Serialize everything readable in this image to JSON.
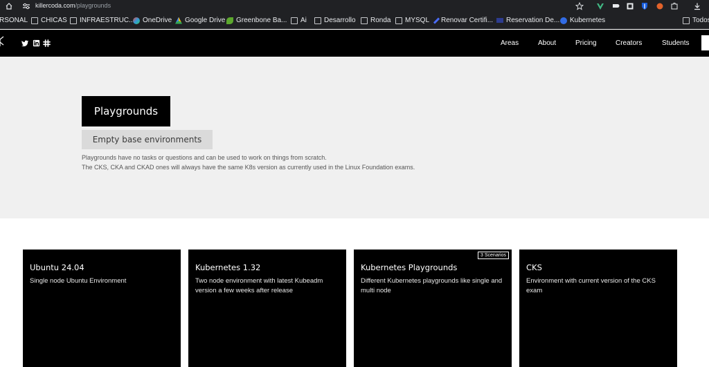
{
  "browser": {
    "url_host": "killercoda.com",
    "url_path": "/playgrounds",
    "bookmarks": [
      {
        "label": "RSONAL",
        "icon": "folder-icon"
      },
      {
        "label": "CHICAS",
        "icon": "folder-icon"
      },
      {
        "label": "INFRAESTRUC...",
        "icon": "folder-icon"
      },
      {
        "label": "OneDrive",
        "icon": "onedrive-icon"
      },
      {
        "label": "Google Drive",
        "icon": "google-drive-icon"
      },
      {
        "label": "Greenbone Ba...",
        "icon": "greenbone-icon"
      },
      {
        "label": "Ai",
        "icon": "folder-icon"
      },
      {
        "label": "Desarrollo",
        "icon": "folder-icon"
      },
      {
        "label": "Ronda",
        "icon": "folder-icon"
      },
      {
        "label": "MYSQL",
        "icon": "folder-icon"
      },
      {
        "label": "Renovar Certifi...",
        "icon": "pen-icon"
      },
      {
        "label": "Reservation De...",
        "icon": "reservation-icon"
      },
      {
        "label": "Kubernetes",
        "icon": "kubernetes-icon"
      },
      {
        "label": "Todos",
        "icon": "folder-icon"
      }
    ]
  },
  "header": {
    "nav": [
      "Areas",
      "About",
      "Pricing",
      "Creators",
      "Students"
    ]
  },
  "hero": {
    "title": "Playgrounds",
    "subtitle": "Empty base environments",
    "desc_line1": "Playgrounds have no tasks or questions and can be used to work on things from scratch.",
    "desc_line2": "The CKS, CKA and CKAD ones will always have the same K8s version as currently used in the Linux Foundation exams."
  },
  "cards": [
    {
      "title": "Ubuntu 24.04",
      "desc": "Single node Ubuntu Environment",
      "badge": ""
    },
    {
      "title": "Kubernetes 1.32",
      "desc": "Two node environment with latest Kubeadm version a few weeks after release",
      "badge": ""
    },
    {
      "title": "Kubernetes Playgrounds",
      "desc": "Different Kubernetes playgrounds like single and multi node",
      "badge": "3 Scenarios"
    },
    {
      "title": "CKS",
      "desc": "Environment with current version of the CKS exam",
      "badge": ""
    }
  ]
}
